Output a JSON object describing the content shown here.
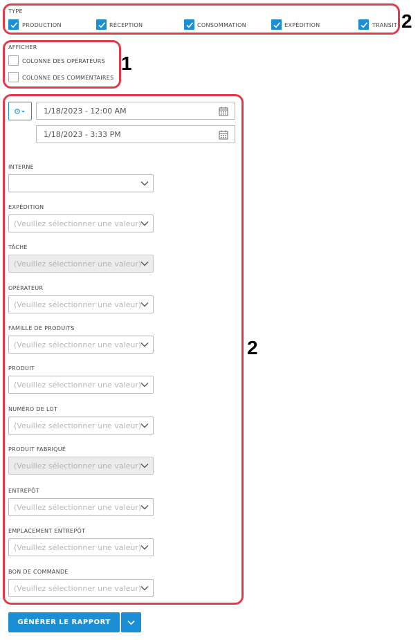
{
  "type_section": {
    "label": "TYPE",
    "options": [
      {
        "label": "PRODUCTION",
        "checked": true
      },
      {
        "label": "RÉCEPTION",
        "checked": true
      },
      {
        "label": "CONSOMMATION",
        "checked": true
      },
      {
        "label": "EXPÉDITION",
        "checked": true
      },
      {
        "label": "TRANSIT",
        "checked": true
      }
    ]
  },
  "afficher_section": {
    "label": "AFFICHER",
    "options": [
      {
        "label": "COLONNE DES OPÉRATEURS",
        "checked": false
      },
      {
        "label": "COLONNE DES COMMENTAIRES",
        "checked": false
      }
    ]
  },
  "date_range": {
    "start": "1/18/2023 - 12:00 AM",
    "end": "1/18/2023 - 3:33 PM",
    "mode_icon": "clock-icon"
  },
  "filters": [
    {
      "label": "INTERNE",
      "value": "",
      "disabled": false
    },
    {
      "label": "EXPÉDITION",
      "value": "(Veuillez sélectionner une valeur)",
      "disabled": false
    },
    {
      "label": "TÂCHE",
      "value": "(Veuillez sélectionner une valeur)",
      "disabled": true
    },
    {
      "label": "OPÉRATEUR",
      "value": "(Veuillez sélectionner une valeur)",
      "disabled": false
    },
    {
      "label": "FAMILLE DE PRODUITS",
      "value": "(Veuillez sélectionner une valeur)",
      "disabled": false
    },
    {
      "label": "PRODUIT",
      "value": "(Veuillez sélectionner une valeur)",
      "disabled": false
    },
    {
      "label": "NUMÉRO DE LOT",
      "value": "(Veuillez sélectionner une valeur)",
      "disabled": false
    },
    {
      "label": "PRODUIT FABRIQUÉ",
      "value": "(Veuillez sélectionner une valeur)",
      "disabled": true
    },
    {
      "label": "ENTREPÔT",
      "value": "(Veuillez sélectionner une valeur)",
      "disabled": false
    },
    {
      "label": "EMPLACEMENT ENTREPÔT",
      "value": "(Veuillez sélectionner une valeur)",
      "disabled": false
    },
    {
      "label": "BON DE COMMANDE",
      "value": "(Veuillez sélectionner une valeur)",
      "disabled": false
    }
  ],
  "generate_button": {
    "label": "GÉNÉRER LE RAPPORT"
  },
  "annotations": [
    {
      "number": "2",
      "target": "type-section"
    },
    {
      "number": "1",
      "target": "afficher-section"
    },
    {
      "number": "2",
      "target": "filters-section"
    }
  ],
  "colors": {
    "accent": "#1a8fd6",
    "annotation": "#e23a4a"
  }
}
